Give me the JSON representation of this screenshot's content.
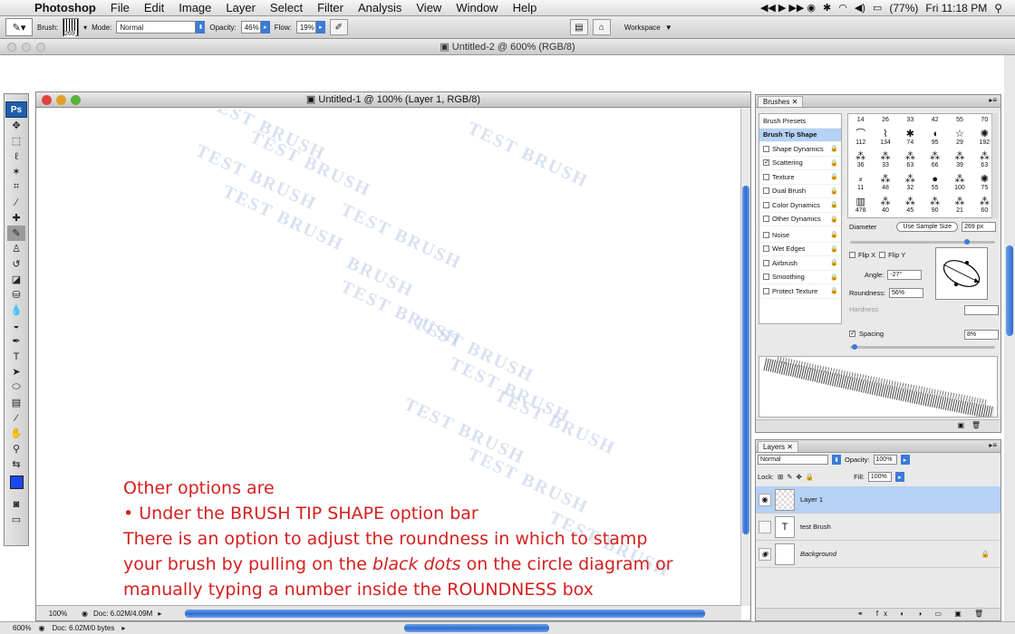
{
  "menubar": {
    "app": "Photoshop",
    "items": [
      "File",
      "Edit",
      "Image",
      "Layer",
      "Select",
      "Filter",
      "Analysis",
      "View",
      "Window",
      "Help"
    ],
    "battery": "(77%)",
    "clock": "Fri 11:18 PM"
  },
  "options": {
    "brush_label": "Brush:",
    "brush_size": "269",
    "mode_label": "Mode:",
    "mode_value": "Normal",
    "opacity_label": "Opacity:",
    "opacity_value": "46%",
    "flow_label": "Flow:",
    "flow_value": "19%",
    "workspace": "Workspace"
  },
  "doc2": {
    "title": "Untitled-2 @ 600% (RGB/8)",
    "zoom": "600%",
    "status": "Doc: 6.02M/0 bytes"
  },
  "doc1": {
    "title": "Untitled-1 @ 100% (Layer 1, RGB/8)",
    "zoom": "100%",
    "status": "Doc: 6.02M/4.09M"
  },
  "canvas_strokes": [
    "TEST BRUSH",
    "TEST BRUSH",
    "TEST BRUSH",
    "TEST BRUSH",
    "TEST BRUSH",
    "TEST BRUSH",
    "BRUSH",
    "TEST BRUSH",
    "TEST BRUSH",
    "TEST BRUSH",
    "TEST BRUSH",
    "TEST BRUSH",
    "TEST BRUSH",
    "TEST BRUSH"
  ],
  "instructions": {
    "line1": "Other options are",
    "line2": "• Under the BRUSH TIP SHAPE option bar",
    "line3": "There is an option to adjust the roundness in which to stamp",
    "line4a": "your brush by pulling on the ",
    "line4b": "black dots",
    "line4c": " on the circle diagram or",
    "line5": "manually typing a number inside the ROUNDNESS box"
  },
  "brushes": {
    "tab": "Brushes",
    "presets": "Brush Presets",
    "tip": "Brush Tip Shape",
    "options": [
      {
        "label": "Shape Dynamics",
        "checked": false
      },
      {
        "label": "Scattering",
        "checked": true
      },
      {
        "label": "Texture",
        "checked": false
      },
      {
        "label": "Dual Brush",
        "checked": false
      },
      {
        "label": "Color Dynamics",
        "checked": false
      },
      {
        "label": "Other Dynamics",
        "checked": false
      },
      {
        "label": "Noise",
        "checked": false
      },
      {
        "label": "Wet Edges",
        "checked": false
      },
      {
        "label": "Airbrush",
        "checked": false
      },
      {
        "label": "Smoothing",
        "checked": false
      },
      {
        "label": "Protect Texture",
        "checked": false
      }
    ],
    "grid": [
      {
        "top": "14"
      },
      {
        "top": "26"
      },
      {
        "top": "33"
      },
      {
        "top": "42"
      },
      {
        "top": "55"
      },
      {
        "top": "70"
      },
      {
        "glyph": "⌒",
        "n": "112"
      },
      {
        "glyph": "⌇",
        "n": "134"
      },
      {
        "glyph": "✱",
        "n": "74"
      },
      {
        "glyph": "◖",
        "n": "95"
      },
      {
        "glyph": "☆",
        "n": "29"
      },
      {
        "glyph": "✺",
        "n": "192"
      },
      {
        "glyph": "⁂",
        "n": "36"
      },
      {
        "glyph": "⁂",
        "n": "33"
      },
      {
        "glyph": "⁂",
        "n": "63"
      },
      {
        "glyph": "⁂",
        "n": "66"
      },
      {
        "glyph": "⁂",
        "n": "39"
      },
      {
        "glyph": "⁂",
        "n": "63"
      },
      {
        "glyph": "⸗",
        "n": "11"
      },
      {
        "glyph": "⁂",
        "n": "48"
      },
      {
        "glyph": "⁂",
        "n": "32"
      },
      {
        "glyph": "●",
        "n": "55"
      },
      {
        "glyph": "⁂",
        "n": "100"
      },
      {
        "glyph": "✺",
        "n": "75"
      },
      {
        "glyph": "▥",
        "n": "478"
      },
      {
        "glyph": "⁂",
        "n": "40"
      },
      {
        "glyph": "⁂",
        "n": "45"
      },
      {
        "glyph": "⁂",
        "n": "90"
      },
      {
        "glyph": "⁂",
        "n": "21"
      },
      {
        "glyph": "⁂",
        "n": "60"
      }
    ],
    "diameter_label": "Diameter",
    "use_sample": "Use Sample Size",
    "diameter": "269 px",
    "flipx": "Flip X",
    "flipy": "Flip Y",
    "angle_label": "Angle:",
    "angle": "-27°",
    "roundness_label": "Roundness:",
    "roundness": "56%",
    "hardness_label": "Hardness",
    "spacing_label": "Spacing",
    "spacing": "8%"
  },
  "layers": {
    "tab": "Layers",
    "blend": "Normal",
    "opacity_label": "Opacity:",
    "opacity": "100%",
    "lock_label": "Lock:",
    "fill_label": "Fill:",
    "fill": "100%",
    "rows": [
      {
        "name": "Layer 1",
        "selected": true,
        "thumb": "transparent"
      },
      {
        "name": "test Brush",
        "selected": false,
        "thumb": "T"
      },
      {
        "name": "Background",
        "selected": false,
        "thumb": "white"
      }
    ]
  }
}
